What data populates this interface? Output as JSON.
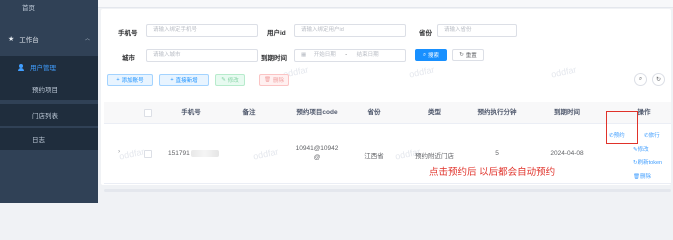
{
  "sidebar": {
    "top_item": "首页",
    "group": "工作台",
    "items": [
      {
        "label": "用户管理",
        "active": true
      },
      {
        "label": "预约项目",
        "active": false
      },
      {
        "label": "门店列表",
        "active": false
      },
      {
        "label": "日志",
        "active": false
      }
    ]
  },
  "filters": {
    "phone_label": "手机号",
    "phone_placeholder": "请输入绑定手机号",
    "userid_label": "用户id",
    "userid_placeholder": "请输入绑定用户id",
    "province_label": "省份",
    "province_placeholder": "请输入省份",
    "city_label": "城市",
    "city_placeholder": "请输入城市",
    "expire_label": "到期时间",
    "date_start": "开始日期",
    "date_sep": "-",
    "date_end": "结束日期",
    "search_label": "搜索",
    "reset_label": "重置"
  },
  "toolbar": {
    "add_label": "添加账号",
    "batch_label": "直接新增",
    "edit_label": "修改",
    "delete_label": "删除",
    "search_icon": "search-icon",
    "refresh_icon": "refresh-icon"
  },
  "table": {
    "columns": [
      "手机号",
      "备注",
      "预约项目code",
      "省份",
      "类型",
      "预约执行分钟",
      "到期时间",
      "操作"
    ],
    "row": {
      "phone": "151791",
      "code_line1": "10941@10942",
      "code_line2": "@",
      "province": "江西省",
      "type": "预约附近门店",
      "minutes": "5",
      "expire": "2024-04-08",
      "ops": [
        "预约",
        "旅行",
        "修改",
        "刷新token",
        "删除"
      ]
    }
  },
  "annotation": "点击预约后 以后都会自动预约",
  "watermark": "oddfar",
  "colors": {
    "primary": "#1890ff",
    "highlight": "#e0322a",
    "sidebar": "#304156"
  }
}
